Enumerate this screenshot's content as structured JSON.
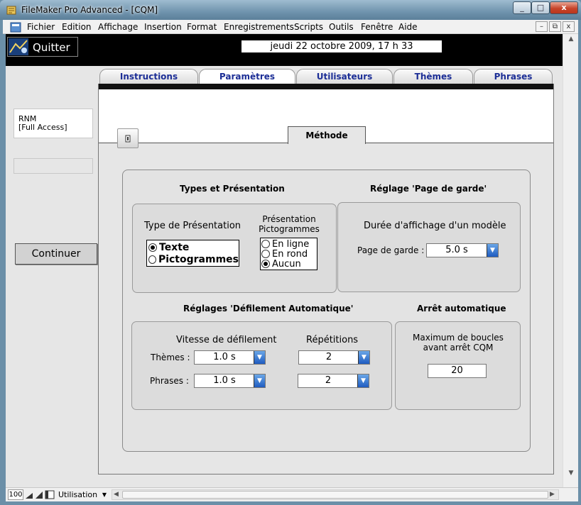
{
  "window": {
    "title": "FileMaker Pro Advanced - [CQM]",
    "close_glyph": "x",
    "min_glyph": "_",
    "max_glyph": "□"
  },
  "menu": {
    "items": [
      "Fichier",
      "Edition",
      "Affichage",
      "Insertion",
      "Format",
      "Enregistrements",
      "Scripts",
      "Outils",
      "Fenêtre",
      "Aide"
    ],
    "mdi_buttons": [
      "–",
      "⧉",
      "x"
    ]
  },
  "header": {
    "quit_label": "Quitter",
    "datetime": "jeudi 22 octobre 2009, 17 h 33"
  },
  "sidebar": {
    "user_name": "RNM",
    "user_access": "[Full Access]",
    "continue_label": "Continuer"
  },
  "tabs": [
    {
      "label": "Instructions",
      "active": false
    },
    {
      "label": "Paramètres",
      "active": true
    },
    {
      "label": "Utilisateurs",
      "active": false
    },
    {
      "label": "Thèmes",
      "active": false
    },
    {
      "label": "Phrases",
      "active": false
    }
  ],
  "subtab": {
    "label": "Méthode"
  },
  "types": {
    "section_title": "Types et Présentation",
    "type_label": "Type de Présentation",
    "type_options": [
      {
        "label": "Texte",
        "selected": true
      },
      {
        "label": "Pictogrammes",
        "selected": false
      }
    ],
    "picto_label_1": "Présentation",
    "picto_label_2": "Pictogrammes",
    "picto_options": [
      {
        "label": "En ligne",
        "selected": false
      },
      {
        "label": "En rond",
        "selected": false
      },
      {
        "label": "Aucun",
        "selected": true
      }
    ]
  },
  "cover": {
    "section_title": "Réglage 'Page de garde'",
    "duration_label": "Durée d'affichage d'un modèle",
    "field_label": "Page de garde :",
    "value": "5.0 s"
  },
  "scroll": {
    "section_title": "Réglages 'Défilement Automatique'",
    "speed_label": "Vitesse de défilement",
    "repeat_label": "Répétitions",
    "themes_label": "Thèmes :",
    "phrases_label": "Phrases :",
    "themes_speed": "1.0 s",
    "themes_repeat": "2",
    "phrases_speed": "1.0 s",
    "phrases_repeat": "2"
  },
  "autostop": {
    "section_title": "Arrêt automatique",
    "label_1": "Maximum de boucles",
    "label_2": "avant arrêt CQM",
    "value": "20"
  },
  "status": {
    "zoom": "100",
    "mode": "Utilisation"
  }
}
